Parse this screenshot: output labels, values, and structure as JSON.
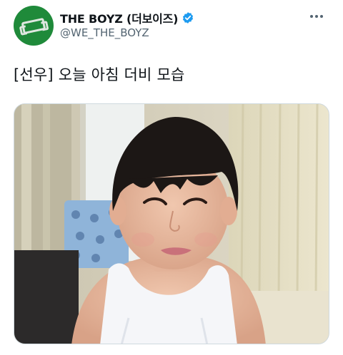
{
  "tweet": {
    "author": {
      "display_name": "THE BOYZ (더보이즈)",
      "handle": "@WE_THE_BOYZ",
      "verified": true,
      "avatar_icon": "the-boyz-logo-icon",
      "avatar_color": "#1f8a3a"
    },
    "more_icon": "more-dots-icon",
    "text": "[선우] 오늘 아침 더비 모습",
    "media": {
      "type": "photo"
    }
  },
  "colors": {
    "text": "#0f1419",
    "secondary": "#536471",
    "verified": "#1d9bf0"
  }
}
